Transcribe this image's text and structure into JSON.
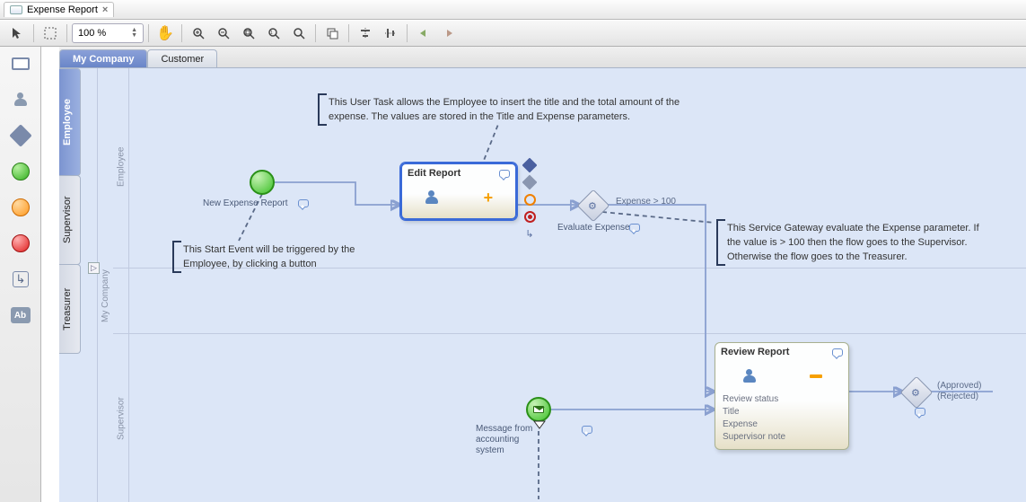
{
  "tab": {
    "title": "Expense Report",
    "close": "×"
  },
  "toolbar": {
    "zoom": "100 %"
  },
  "pools": {
    "active": "My Company",
    "inactive": "Customer"
  },
  "lanes": {
    "employee": "Employee",
    "supervisor": "Supervisor",
    "treasurer": "Treasurer"
  },
  "pool_label": "My Company",
  "lane_axis": {
    "employee": "Employee",
    "supervisor": "Supervisor"
  },
  "nodes": {
    "start": {
      "label": "New Expense Report"
    },
    "edit": {
      "title": "Edit Report"
    },
    "gateway": {
      "label": "Evaluate Expense"
    },
    "cond": {
      "gt": "Expense > 100"
    },
    "msg": {
      "label": "Message from accounting system"
    },
    "review": {
      "title": "Review Report",
      "fields": [
        "Review status",
        "Title",
        "Expense",
        "Supervisor note"
      ]
    },
    "gateway2": {
      "approved": "(Approved)",
      "rejected": "(Rejected)"
    }
  },
  "annotations": {
    "start": "This Start Event will be triggered by the Employee, by clicking a button",
    "edit": "This User Task allows the Employee to insert the title and the total amount of the expense. The values are stored in the Title and Expense parameters.",
    "gateway": "This Service Gateway evaluate the Expense parameter. If the value is > 100 then the flow goes to the Supervisor. Otherwise the flow goes to the Treasurer."
  },
  "palette": {
    "ab": "Ab"
  },
  "chart_data": {
    "type": "bpmn_diagram",
    "pools": [
      {
        "name": "My Company",
        "lanes": [
          "Employee",
          "Supervisor",
          "Treasurer"
        ],
        "active": true
      },
      {
        "name": "Customer",
        "lanes": [],
        "active": false
      }
    ],
    "nodes": [
      {
        "id": "start",
        "type": "start_event",
        "lane": "Employee",
        "label": "New Expense Report"
      },
      {
        "id": "edit",
        "type": "user_task",
        "lane": "Employee",
        "label": "Edit Report",
        "selected": true
      },
      {
        "id": "gw1",
        "type": "exclusive_gateway",
        "lane": "Employee",
        "label": "Evaluate Expense",
        "service": true
      },
      {
        "id": "msg",
        "type": "message_intermediate_event",
        "lane": "Supervisor",
        "label": "Message from accounting system"
      },
      {
        "id": "review",
        "type": "user_task",
        "lane": "Supervisor",
        "label": "Review Report",
        "fields": [
          "Review status",
          "Title",
          "Expense",
          "Supervisor note"
        ]
      },
      {
        "id": "gw2",
        "type": "exclusive_gateway",
        "lane": "Supervisor",
        "service": true
      }
    ],
    "edges": [
      {
        "from": "start",
        "to": "edit",
        "type": "sequence"
      },
      {
        "from": "edit",
        "to": "gw1",
        "type": "sequence"
      },
      {
        "from": "gw1",
        "to": "review",
        "type": "sequence",
        "condition": "Expense > 100"
      },
      {
        "from": "msg",
        "to": "review",
        "type": "sequence"
      },
      {
        "from": "review",
        "to": "gw2",
        "type": "sequence"
      },
      {
        "from": "gw2",
        "to": null,
        "type": "sequence",
        "condition": "(Approved)"
      },
      {
        "from": "gw2",
        "to": null,
        "type": "sequence",
        "condition": "(Rejected)"
      }
    ],
    "annotations": [
      {
        "target": "start",
        "text": "This Start Event will be triggered by the Employee, by clicking a button"
      },
      {
        "target": "edit",
        "text": "This User Task allows the Employee to insert the title and the total amount of the expense. The values are stored in the Title and Expense parameters."
      },
      {
        "target": "gw1",
        "text": "This Service Gateway evaluate the Expense parameter. If the value is > 100 then the flow goes to the Supervisor. Otherwise the flow goes to the Treasurer."
      }
    ]
  }
}
